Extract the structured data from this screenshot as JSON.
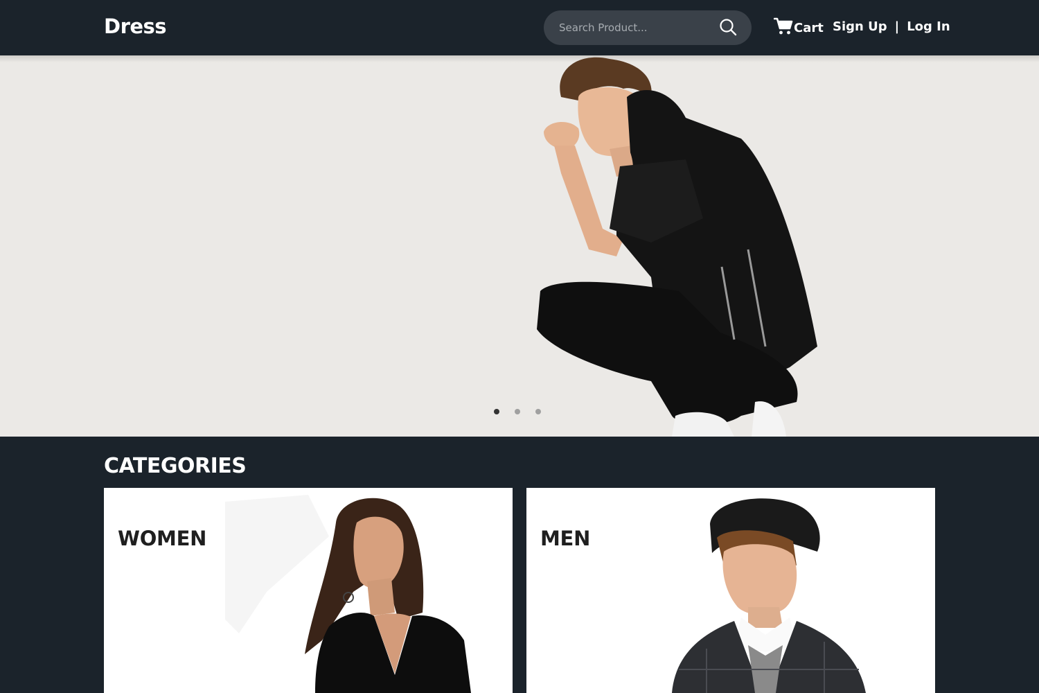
{
  "header": {
    "logo": "Dress",
    "search_placeholder": "Search Product...",
    "search_icon": "search-icon",
    "cart_icon": "cart-icon",
    "cart_label": "Cart",
    "signup_label": "Sign Up",
    "separator": "|",
    "login_label": "Log In"
  },
  "hero": {
    "slide_count": 3,
    "active_slide": 1
  },
  "categories": {
    "title": "CATEGORIES",
    "items": [
      {
        "label": "WOMEN"
      },
      {
        "label": "MEN"
      }
    ]
  },
  "colors": {
    "header_bg": "#1b232b",
    "hero_bg": "#ebe9e6",
    "search_bg": "#3a4149"
  }
}
